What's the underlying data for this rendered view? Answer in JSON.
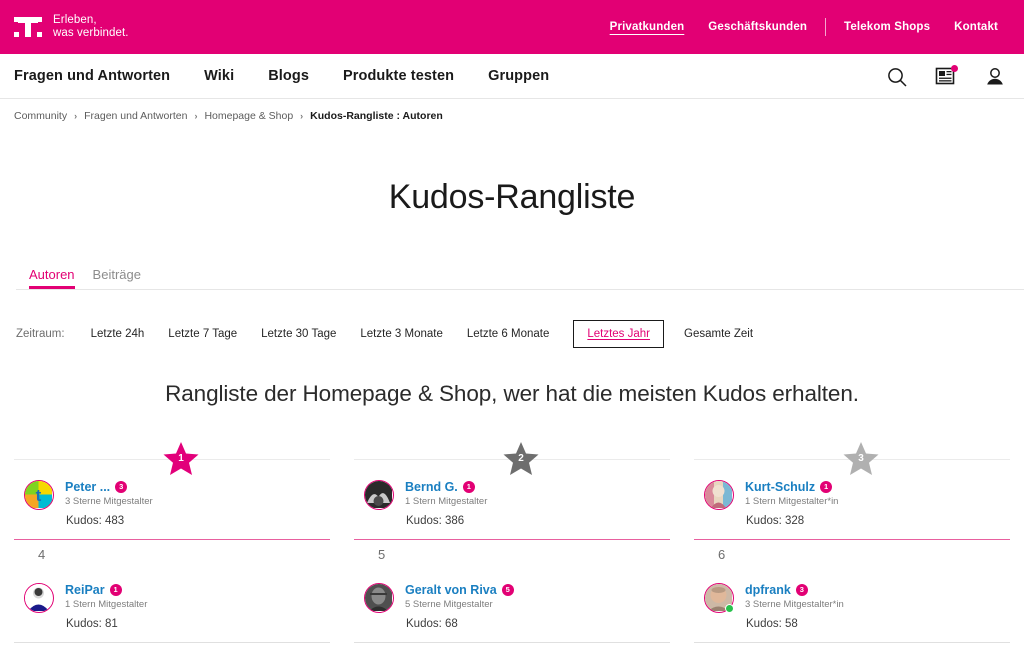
{
  "topbar": {
    "claim": "Erleben,\nwas verbindet.",
    "links": [
      {
        "label": "Privatkunden",
        "active": true
      },
      {
        "label": "Geschäftskunden",
        "active": false
      },
      {
        "label": "Telekom Shops",
        "active": false
      },
      {
        "label": "Kontakt",
        "active": false
      }
    ],
    "brand_color": "#e20074"
  },
  "mainnav": {
    "items": [
      {
        "label": "Fragen und Antworten"
      },
      {
        "label": "Wiki"
      },
      {
        "label": "Blogs"
      },
      {
        "label": "Produkte testen"
      },
      {
        "label": "Gruppen"
      }
    ],
    "icons": [
      {
        "name": "search-icon"
      },
      {
        "name": "news-icon",
        "has_badge": true
      },
      {
        "name": "user-account-icon"
      }
    ]
  },
  "breadcrumb": {
    "separator": "›",
    "items": [
      {
        "label": "Community",
        "current": false
      },
      {
        "label": "Fragen und Antworten",
        "current": false
      },
      {
        "label": "Homepage & Shop",
        "current": false
      },
      {
        "label": "Kudos-Rangliste : Autoren",
        "current": true
      }
    ]
  },
  "page": {
    "title": "Kudos-Rangliste",
    "section_heading": "Rangliste der Homepage & Shop, wer hat die meisten Kudos erhalten."
  },
  "tabs": [
    {
      "label": "Autoren",
      "active": true
    },
    {
      "label": "Beiträge",
      "active": false
    }
  ],
  "filters": {
    "label": "Zeitraum:",
    "options": [
      {
        "label": "Letzte 24h",
        "selected": false
      },
      {
        "label": "Letzte 7 Tage",
        "selected": false
      },
      {
        "label": "Letzte 30 Tage",
        "selected": false
      },
      {
        "label": "Letzte 3 Monate",
        "selected": false
      },
      {
        "label": "Letzte 6 Monate",
        "selected": false
      },
      {
        "label": "Letztes Jahr",
        "selected": true
      },
      {
        "label": "Gesamte Zeit",
        "selected": false
      }
    ]
  },
  "leaderboard": {
    "kudos_prefix": "Kudos: ",
    "entries": [
      {
        "rank": "1",
        "medal": true,
        "star_color": "#e2007a",
        "username": "Peter ...",
        "badge": "3",
        "role": "3 Sterne Mitgestalter",
        "kudos": "Kudos: 483",
        "online": false,
        "avatar_kind": "logo-t"
      },
      {
        "rank": "2",
        "medal": true,
        "star_color": "#6e6e6e",
        "username": "Bernd G.",
        "badge": "1",
        "role": "1 Stern Mitgestalter",
        "kudos": "Kudos: 386",
        "online": false,
        "avatar_kind": "photo-dark"
      },
      {
        "rank": "3",
        "medal": true,
        "star_color": "#b0b0b0",
        "username": "Kurt-Schulz",
        "badge": "1",
        "role": "1 Stern Mitgestalter*in",
        "kudos": "Kudos: 328",
        "online": false,
        "avatar_kind": "photo-colorful"
      },
      {
        "rank": "4",
        "medal": false,
        "star_color": "",
        "username": "ReiPar",
        "badge": "1",
        "role": "1 Stern Mitgestalter",
        "kudos": "Kudos: 81",
        "online": false,
        "avatar_kind": "photo-blue"
      },
      {
        "rank": "5",
        "medal": false,
        "star_color": "",
        "username": "Geralt von Riva",
        "badge": "5",
        "role": "5 Sterne Mitgestalter",
        "kudos": "Kudos: 68",
        "online": false,
        "avatar_kind": "photo-gray"
      },
      {
        "rank": "6",
        "medal": false,
        "star_color": "",
        "username": "dpfrank",
        "badge": "3",
        "role": "3 Sterne Mitgestalter*in",
        "kudos": "Kudos: 58",
        "online": true,
        "avatar_kind": "photo-skin"
      }
    ]
  }
}
